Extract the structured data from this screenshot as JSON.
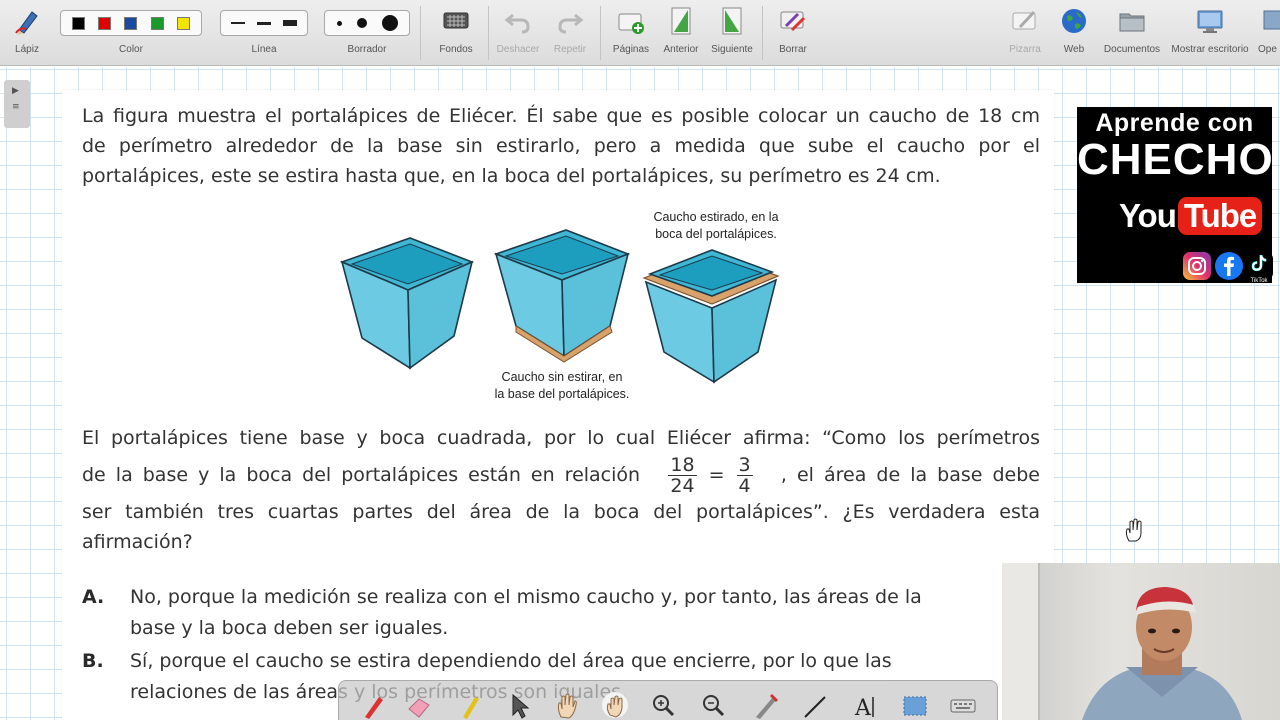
{
  "toolbar": {
    "pencil_label": "Lápiz",
    "color_label": "Color",
    "line_label": "Línea",
    "eraser_label": "Borrador",
    "backgrounds_label": "Fondos",
    "undo_label": "Deshacer",
    "redo_label": "Repetir",
    "pages_label": "Páginas",
    "previous_label": "Anterior",
    "next_label": "Siguiente",
    "clear_label": "Borrar",
    "whiteboard_label": "Pizarra",
    "web_label": "Web",
    "documents_label": "Documentos",
    "show_desktop_label": "Mostrar escritorio",
    "more_label": "Ope",
    "colors": [
      "#000000",
      "#e00000",
      "#1a4aa0",
      "#1a9a2a",
      "#f2e600"
    ]
  },
  "problem": {
    "intro_lines": [
      "La figura muestra el portalápices de Eliécer. Él sabe que es posible colocar un caucho de 18 cm",
      "de perímetro alrededor de la base sin estirarlo, pero a medida que sube el caucho por el",
      "portalápices, este se estira hasta que, en la boca del portalápices, su perímetro es 24 cm."
    ],
    "caption_top_1": "Caucho estirado, en la",
    "caption_top_2": "boca del portalápices.",
    "caption_bottom_1": "Caucho sin estirar, en",
    "caption_bottom_2": "la base del portalápices.",
    "body_line1": "El portalápices tiene base y boca cuadrada, por lo cual Eliécer afirma: “Como los perímetros",
    "body_line2_pre": "de la base y la boca del portalápices están en relación",
    "frac1_num": "18",
    "frac1_den": "24",
    "equals": "=",
    "frac2_num": "3",
    "frac2_den": "4",
    "body_line2_post": ", el área de la base debe",
    "body_line3": "ser también tres cuartas partes del área de la boca del portalápices”. ¿Es verdadera esta",
    "body_line4": "afirmación?",
    "options": [
      {
        "letter": "A.",
        "line1": "No, porque la medición se realiza con el mismo caucho y, por tanto, las áreas de la",
        "line2": "base y la boca deben ser iguales."
      },
      {
        "letter": "B.",
        "line1": "Sí, porque el caucho se estira dependiendo del área que encierre, por lo que las",
        "line2": "relaciones de las áreas y los perímetros son iguales."
      }
    ]
  },
  "logo": {
    "line1": "Aprende con",
    "line2": "CHECHO",
    "you": "You",
    "tube": "Tube",
    "tiktok_label": "TikTok"
  }
}
